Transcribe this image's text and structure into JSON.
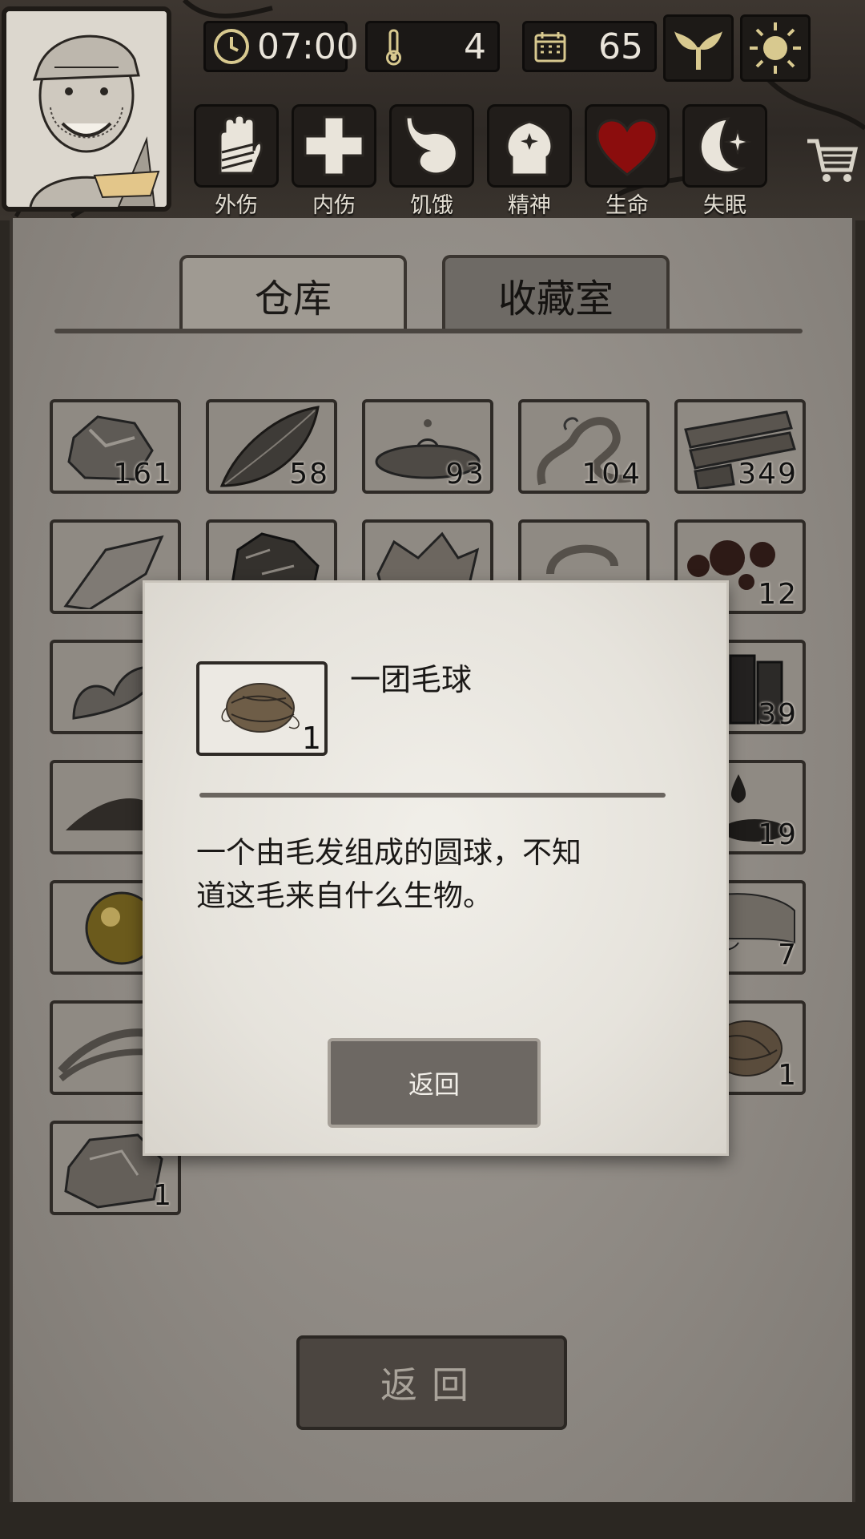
{
  "hud": {
    "time": "07:00",
    "temperature": "4",
    "day": "65",
    "status_labels": [
      "外伤",
      "内伤",
      "饥饿",
      "精神",
      "生命",
      "失眠"
    ]
  },
  "tabs": {
    "warehouse": "仓库",
    "collection": "收藏室"
  },
  "inventory": {
    "counts": [
      "161",
      "58",
      "93",
      "104",
      "349",
      "12",
      "39",
      "19",
      "7",
      "1",
      "1"
    ]
  },
  "dialog": {
    "item_name": "一团毛球",
    "item_count": "1",
    "description_line1": "一个由毛发组成的圆球，不知",
    "description_line2": "道这毛来自什么生物。",
    "back_label": "返回"
  },
  "footer": {
    "back_label": "返回"
  },
  "colors": {
    "life_heart": "#8b0d0d",
    "panel": "#8f8a84",
    "dialog_paper": "#ebe8e2"
  }
}
